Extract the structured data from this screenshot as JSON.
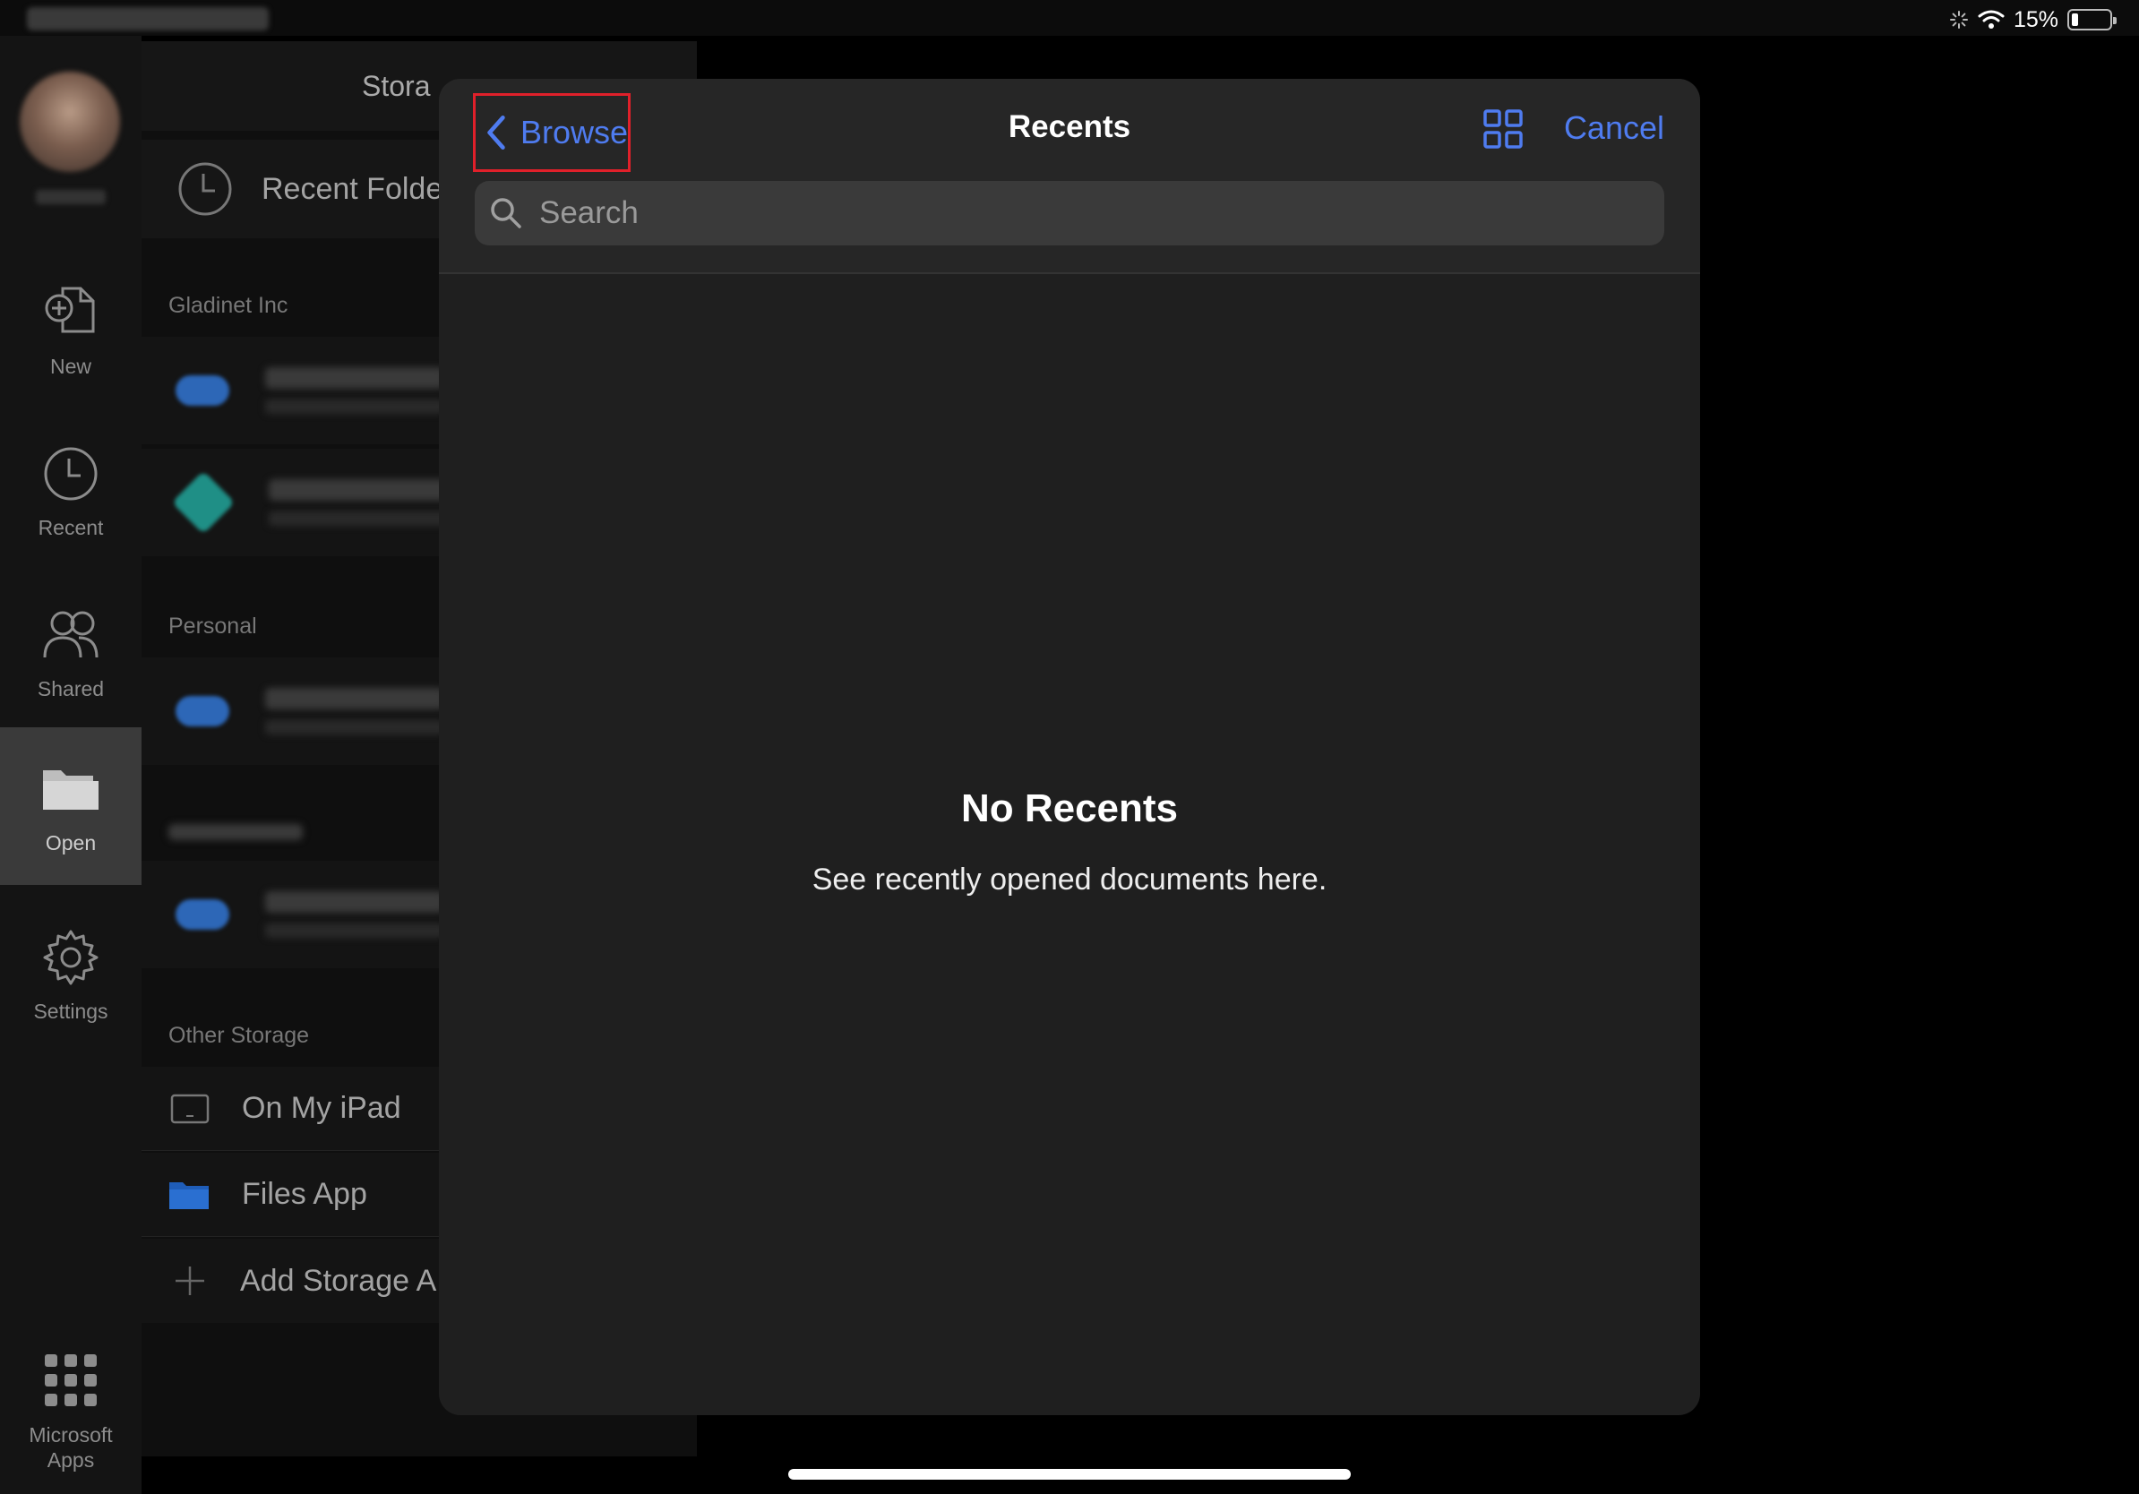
{
  "status_bar": {
    "battery_text": "15%"
  },
  "rail": {
    "new_label": "New",
    "recent_label": "Recent",
    "shared_label": "Shared",
    "open_label": "Open",
    "settings_label": "Settings",
    "apps_label_line1": "Microsoft",
    "apps_label_line2": "Apps"
  },
  "storage": {
    "header": "Stora",
    "recent_folders": "Recent Folde",
    "section_gladinet": "Gladinet Inc",
    "section_personal": "Personal",
    "section_other": "Other Storage",
    "on_my_ipad": "On My iPad",
    "files_app": "Files App",
    "add_storage": "Add Storage A"
  },
  "modal": {
    "browse_label": "Browse",
    "title": "Recents",
    "cancel_label": "Cancel",
    "search_placeholder": "Search",
    "empty_title": "No Recents",
    "empty_subtitle": "See recently opened documents here."
  },
  "colors": {
    "accent": "#4f7cf0",
    "highlight_box": "#e0202a",
    "active_rail": "#3a3a3a"
  },
  "icons": {
    "back": "chevron-left-icon",
    "grid": "grid-view-icon",
    "search": "magnifier-icon",
    "folder": "folder-icon"
  }
}
